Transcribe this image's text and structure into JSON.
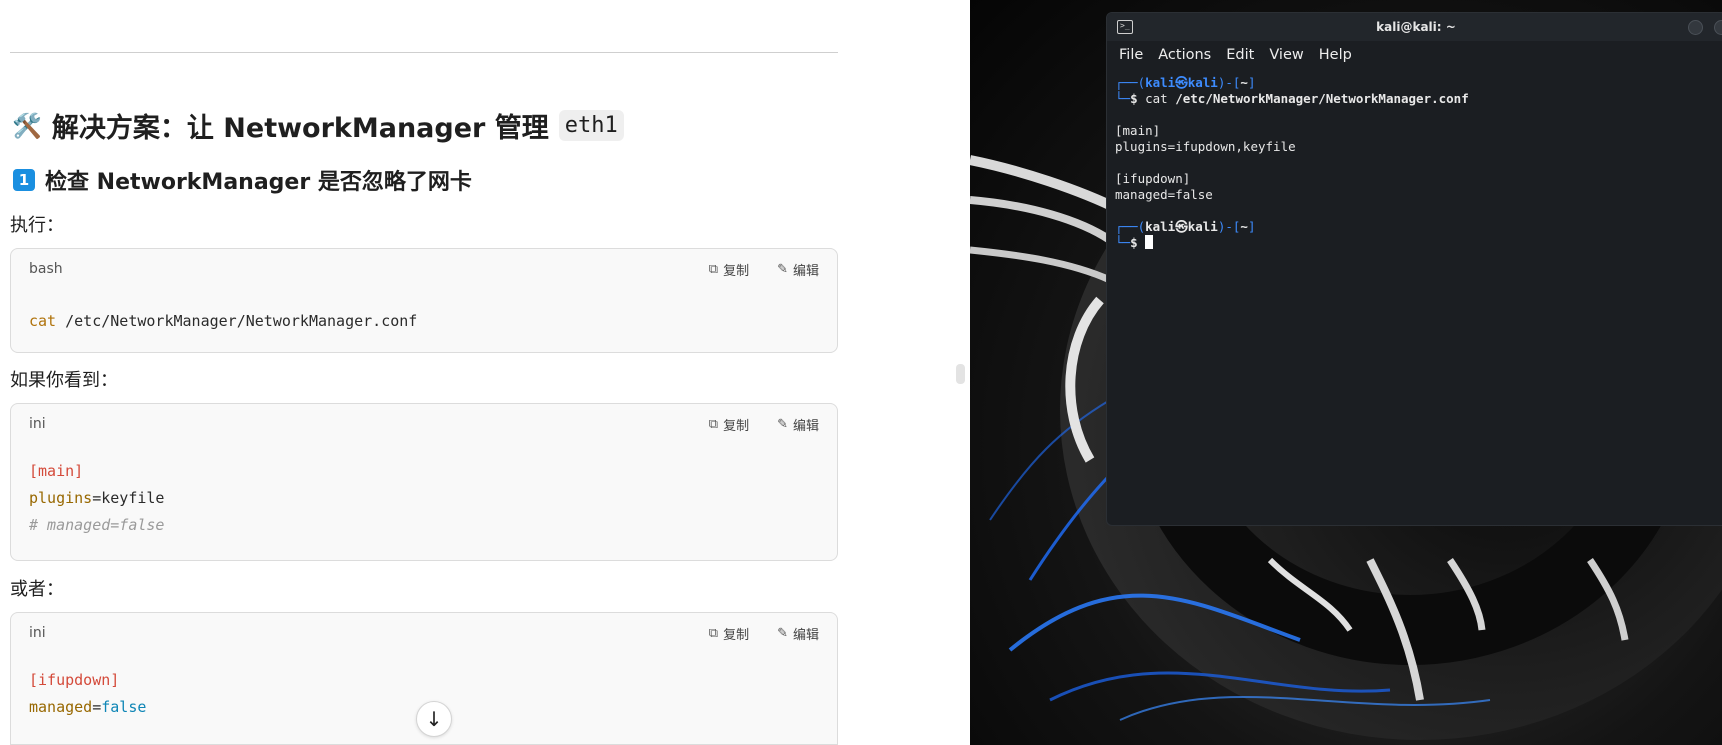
{
  "chat": {
    "heading": {
      "emoji": "🛠️",
      "text": "解决方案：让 NetworkManager 管理",
      "code": "eth1"
    },
    "subheading": {
      "number": "1",
      "text": "检查 NetworkManager 是否忽略了网卡"
    },
    "paragraphs": {
      "execute": "执行：",
      "if_you_see": "如果你看到：",
      "or": "或者："
    },
    "code_actions": {
      "copy": "复制",
      "edit": "编辑"
    },
    "code_blocks": [
      {
        "lang": "bash",
        "cmd": "cat",
        "arg": " /etc/NetworkManager/NetworkManager.conf"
      },
      {
        "lang": "ini",
        "section": "[main]",
        "key": "plugins",
        "value": "=keyfile",
        "comment": "# managed=false"
      },
      {
        "lang": "ini",
        "section": "[ifupdown]",
        "key": "managed",
        "eq": "=",
        "value": "false"
      }
    ]
  },
  "terminal": {
    "title": "kali@kali: ~",
    "menu": [
      "File",
      "Actions",
      "Edit",
      "View",
      "Help"
    ],
    "prompt_top": "┌──(",
    "prompt_user": "kali㉿kali",
    "prompt_mid": ")-[",
    "prompt_dir": "~",
    "prompt_end": "]",
    "prompt_bottom": "└─",
    "prompt_dollar": "$",
    "command": " cat ",
    "command_arg": "/etc/NetworkManager/NetworkManager.conf",
    "output": [
      "[main]",
      "plugins=ifupdown,keyfile",
      "",
      "[ifupdown]",
      "managed=false"
    ]
  },
  "colors": {
    "accent_blue": "#1a8fe0",
    "terminal_blue": "#3d8cff",
    "terminal_bg": "#1b1e22"
  }
}
